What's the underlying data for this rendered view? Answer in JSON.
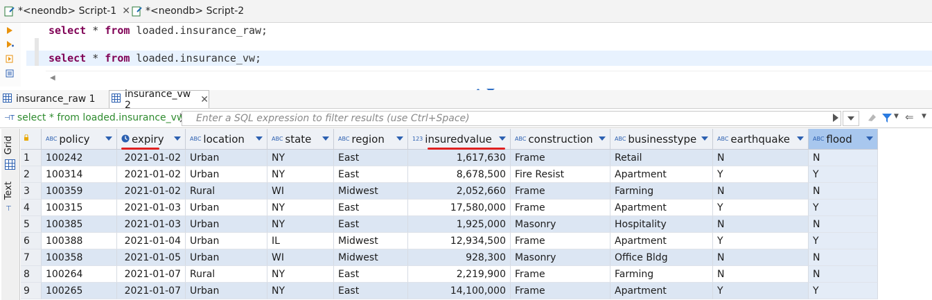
{
  "editor_tabs": [
    {
      "label": "*<neondb> Script-1",
      "closable": true
    },
    {
      "label": "*<neondb> Script-2",
      "closable": false
    }
  ],
  "editor": {
    "lines": [
      {
        "kw1": "select",
        "rest1": " * ",
        "kw2": "from",
        "rest2": " loaded.insurance_raw;"
      },
      {
        "kw1": "select",
        "rest1": " * ",
        "kw2": "from",
        "rest2": " loaded.insurance_vw;"
      }
    ]
  },
  "result_tabs": [
    {
      "label": "insurance_raw 1"
    },
    {
      "label": "insurance_vw 2",
      "closable": true
    }
  ],
  "filter": {
    "query": "select * from loaded.insurance_vw",
    "placeholder": "Enter a SQL expression to filter results (use Ctrl+Space)"
  },
  "side_panel": {
    "grid_label": "Grid",
    "text_label": "Text"
  },
  "grid": {
    "columns": [
      {
        "name": "policy",
        "type": "ABC"
      },
      {
        "name": "expiry",
        "type": "clock"
      },
      {
        "name": "location",
        "type": "ABC"
      },
      {
        "name": "state",
        "type": "ABC"
      },
      {
        "name": "region",
        "type": "ABC"
      },
      {
        "name": "insuredvalue",
        "type": "123"
      },
      {
        "name": "construction",
        "type": "ABC"
      },
      {
        "name": "businesstype",
        "type": "ABC"
      },
      {
        "name": "earthquake",
        "type": "ABC"
      },
      {
        "name": "flood",
        "type": "ABC"
      }
    ],
    "rows": [
      [
        "1",
        "100242",
        "2021-01-02",
        "Urban",
        "NY",
        "East",
        "1,617,630",
        "Frame",
        "Retail",
        "N",
        "N"
      ],
      [
        "2",
        "100314",
        "2021-01-02",
        "Urban",
        "NY",
        "East",
        "8,678,500",
        "Fire Resist",
        "Apartment",
        "Y",
        "Y"
      ],
      [
        "3",
        "100359",
        "2021-01-02",
        "Rural",
        "WI",
        "Midwest",
        "2,052,660",
        "Frame",
        "Farming",
        "N",
        "N"
      ],
      [
        "4",
        "100315",
        "2021-01-03",
        "Urban",
        "NY",
        "East",
        "17,580,000",
        "Frame",
        "Apartment",
        "Y",
        "Y"
      ],
      [
        "5",
        "100385",
        "2021-01-03",
        "Urban",
        "NY",
        "East",
        "1,925,000",
        "Masonry",
        "Hospitality",
        "N",
        "N"
      ],
      [
        "6",
        "100388",
        "2021-01-04",
        "Urban",
        "IL",
        "Midwest",
        "12,934,500",
        "Frame",
        "Apartment",
        "Y",
        "Y"
      ],
      [
        "7",
        "100358",
        "2021-01-05",
        "Urban",
        "WI",
        "Midwest",
        "928,300",
        "Masonry",
        "Office Bldg",
        "N",
        "N"
      ],
      [
        "8",
        "100264",
        "2021-01-07",
        "Rural",
        "NY",
        "East",
        "2,219,900",
        "Frame",
        "Farming",
        "N",
        "N"
      ],
      [
        "9",
        "100265",
        "2021-01-07",
        "Urban",
        "NY",
        "East",
        "14,100,000",
        "Frame",
        "Apartment",
        "Y",
        "Y"
      ]
    ]
  },
  "colors": {
    "keyword": "#7f0055",
    "filter_sql": "#2e8b2e",
    "annotation": "#e02020",
    "selected_header": "#a8c7ee"
  }
}
